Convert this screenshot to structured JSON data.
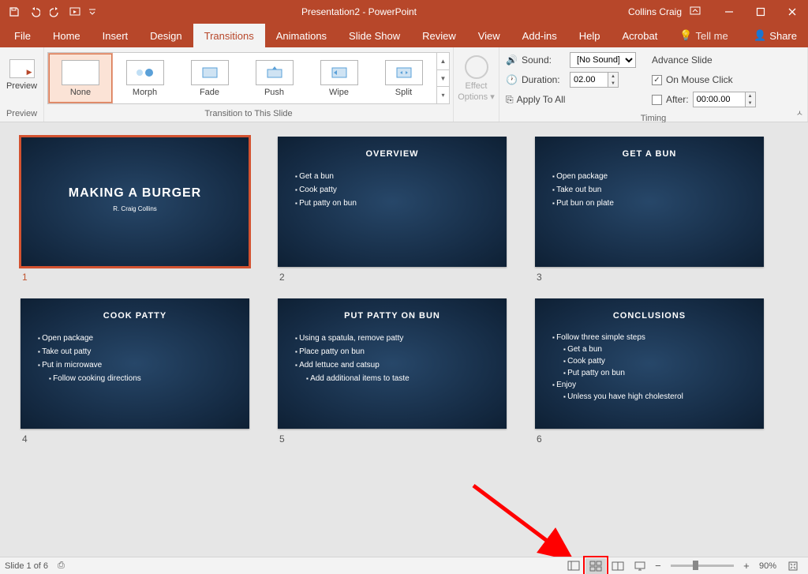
{
  "titlebar": {
    "title": "Presentation2 - PowerPoint",
    "user": "Collins Craig"
  },
  "tabs": {
    "file": "File",
    "home": "Home",
    "insert": "Insert",
    "design": "Design",
    "transitions": "Transitions",
    "animations": "Animations",
    "slideshow": "Slide Show",
    "review": "Review",
    "view": "View",
    "addins": "Add-ins",
    "help": "Help",
    "acrobat": "Acrobat",
    "tellme": "Tell me",
    "share": "Share"
  },
  "ribbon": {
    "preview": {
      "label": "Preview",
      "group": "Preview"
    },
    "gallery": {
      "items": [
        "None",
        "Morph",
        "Fade",
        "Push",
        "Wipe",
        "Split"
      ],
      "group": "Transition to This Slide"
    },
    "effect_options": {
      "label": "Effect\nOptions"
    },
    "timing": {
      "sound_label": "Sound:",
      "sound_value": "[No Sound]",
      "duration_label": "Duration:",
      "duration_value": "02.00",
      "apply_all": "Apply To All",
      "advance_header": "Advance Slide",
      "on_mouse_click": "On Mouse Click",
      "after_label": "After:",
      "after_value": "00:00.00",
      "group": "Timing"
    }
  },
  "slides": [
    {
      "num": "1",
      "title": "MAKING A BURGER",
      "subtitle": "R. Craig Collins"
    },
    {
      "num": "2",
      "title": "OVERVIEW",
      "bullets": [
        "Get a bun",
        "Cook patty",
        "Put patty on bun"
      ]
    },
    {
      "num": "3",
      "title": "GET A BUN",
      "bullets": [
        "Open package",
        "Take out bun",
        "Put bun on plate"
      ]
    },
    {
      "num": "4",
      "title": "COOK PATTY",
      "bullets": [
        "Open package",
        "Take out patty",
        "Put in microwave"
      ],
      "subbullets4": [
        "Follow cooking directions"
      ]
    },
    {
      "num": "5",
      "title": "PUT PATTY ON BUN",
      "bullets": [
        "Using a spatula, remove patty",
        "Place patty on bun",
        "Add lettuce and catsup"
      ],
      "subbullets5": [
        "Add additional items to taste"
      ]
    },
    {
      "num": "6",
      "title": "CONCLUSIONS",
      "bullets6": [
        "Follow three simple steps"
      ],
      "sub6a": [
        "Get a bun",
        "Cook patty",
        "Put patty on bun"
      ],
      "bullets6b": [
        "Enjoy"
      ],
      "sub6b": [
        "Unless you have high cholesterol"
      ]
    }
  ],
  "statusbar": {
    "slide_of": "Slide 1 of 6",
    "zoom": "90%"
  }
}
